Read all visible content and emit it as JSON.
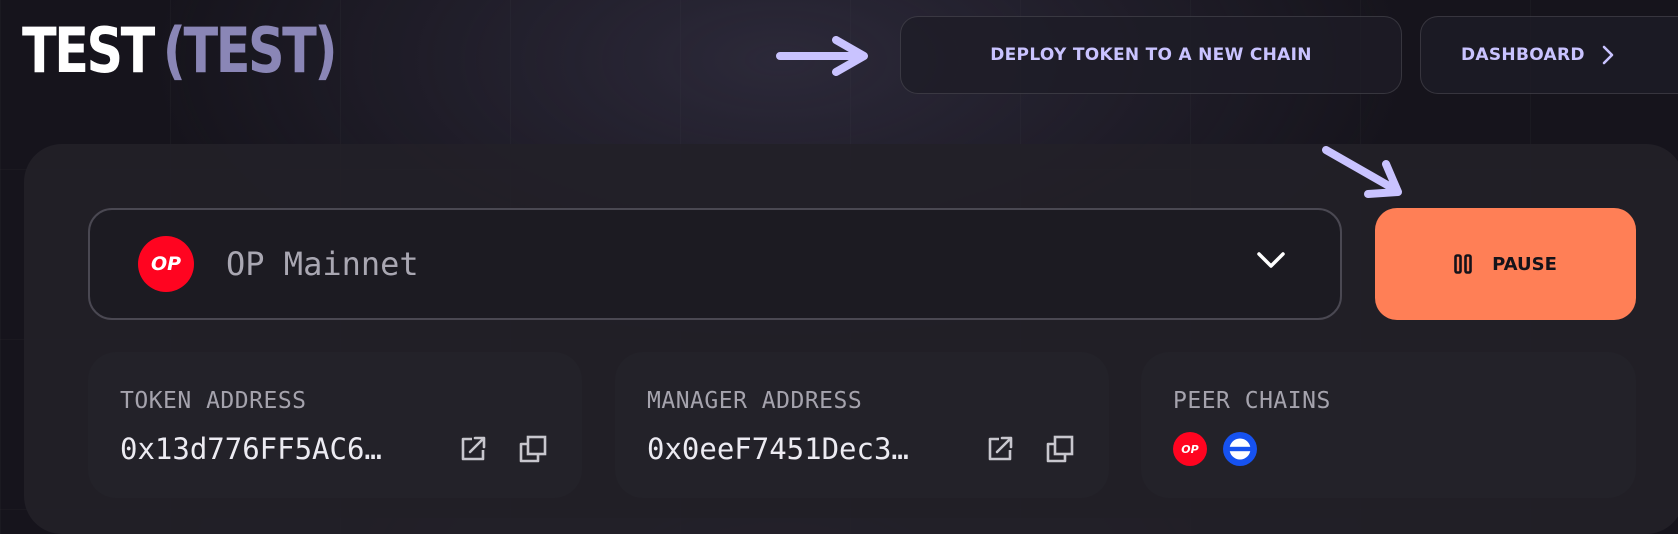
{
  "header": {
    "token_name": "TEST",
    "token_symbol": "(TEST)"
  },
  "actions": {
    "deploy_label": "DEPLOY TOKEN TO A NEW CHAIN",
    "dashboard_label": "DASHBOARD"
  },
  "chain_selector": {
    "logo_text": "OP",
    "selected_chain": "OP Mainnet"
  },
  "pause": {
    "label": "PAUSE"
  },
  "cards": {
    "token_address": {
      "label": "TOKEN ADDRESS",
      "value": "0x13d776FF5AC6…"
    },
    "manager_address": {
      "label": "MANAGER ADDRESS",
      "value": "0x0eeF7451Dec3…"
    },
    "peer_chains": {
      "label": "PEER CHAINS",
      "chains": [
        {
          "logo_text": "OP",
          "icon": "op-mainnet-icon",
          "color": "#ff0420"
        },
        {
          "logo_text": "",
          "icon": "base-chain-icon",
          "color": "#1652f0"
        }
      ]
    }
  },
  "colors": {
    "accent_lavender": "#c9c3ff",
    "pause_orange": "#ff7f56",
    "op_red": "#ff0420",
    "base_blue": "#1652f0"
  }
}
